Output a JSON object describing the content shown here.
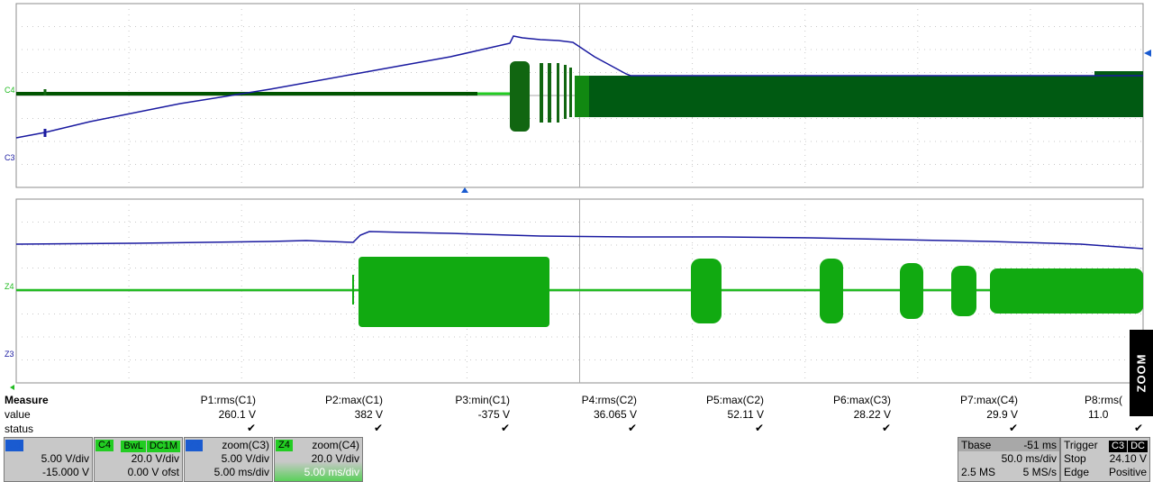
{
  "channel_labels": {
    "top": [
      {
        "name": "C4",
        "color": "#22bb22"
      },
      {
        "name": "C3",
        "color": "#1a1aa0"
      }
    ],
    "bottom": [
      {
        "name": "Z4",
        "color": "#22bb22"
      },
      {
        "name": "Z3",
        "color": "#1a1aa0"
      }
    ]
  },
  "zoom_button": {
    "label": "ZOOM"
  },
  "measure": {
    "title": "Measure",
    "row_labels": {
      "value": "value",
      "status": "status"
    },
    "params": [
      {
        "name": "P1:rms(C1)",
        "value": "260.1 V",
        "status": "✔"
      },
      {
        "name": "P2:max(C1)",
        "value": "382 V",
        "status": "✔"
      },
      {
        "name": "P3:min(C1)",
        "value": "-375 V",
        "status": "✔"
      },
      {
        "name": "P4:rms(C2)",
        "value": "36.065 V",
        "status": "✔"
      },
      {
        "name": "P5:max(C2)",
        "value": "52.11 V",
        "status": "✔"
      },
      {
        "name": "P6:max(C3)",
        "value": "28.22 V",
        "status": "✔"
      },
      {
        "name": "P7:max(C4)",
        "value": "29.9 V",
        "status": "✔"
      },
      {
        "name": "P8:rms(",
        "value": "11.0",
        "status": "✔"
      }
    ]
  },
  "descriptors": {
    "c3": {
      "tag": "C3",
      "flags": [
        "",
        "",
        ""
      ],
      "vdiv": "5.00 V/div",
      "offset": "-15.000 V"
    },
    "c4": {
      "tag": "C4",
      "flags": [
        "BwL",
        "DC1M"
      ],
      "vdiv": "20.0 V/div",
      "offset": "0.00 V ofst"
    },
    "z3": {
      "tag": "Z3",
      "title": "zoom(C3)",
      "vdiv": "5.00 V/div",
      "tdiv": "5.00 ms/div"
    },
    "z4": {
      "tag": "Z4",
      "title": "zoom(C4)",
      "vdiv": "20.0 V/div",
      "tdiv": "5.00 ms/div"
    },
    "tbase": {
      "label": "Tbase",
      "delay": "-51 ms",
      "tdiv": "50.0 ms/div",
      "samples": "2.5 MS",
      "rate": "5 MS/s"
    },
    "trigger": {
      "label": "Trigger",
      "flags": [
        "C3",
        "DC"
      ],
      "mode": "Stop",
      "level": "24.10 V",
      "type": "Edge",
      "slope": "Positive"
    }
  },
  "colors": {
    "c3": "#1a1aa0",
    "c4_top": "#005500",
    "c4_zoom": "#11aa11",
    "grid_dot": "#b0b0b0"
  }
}
